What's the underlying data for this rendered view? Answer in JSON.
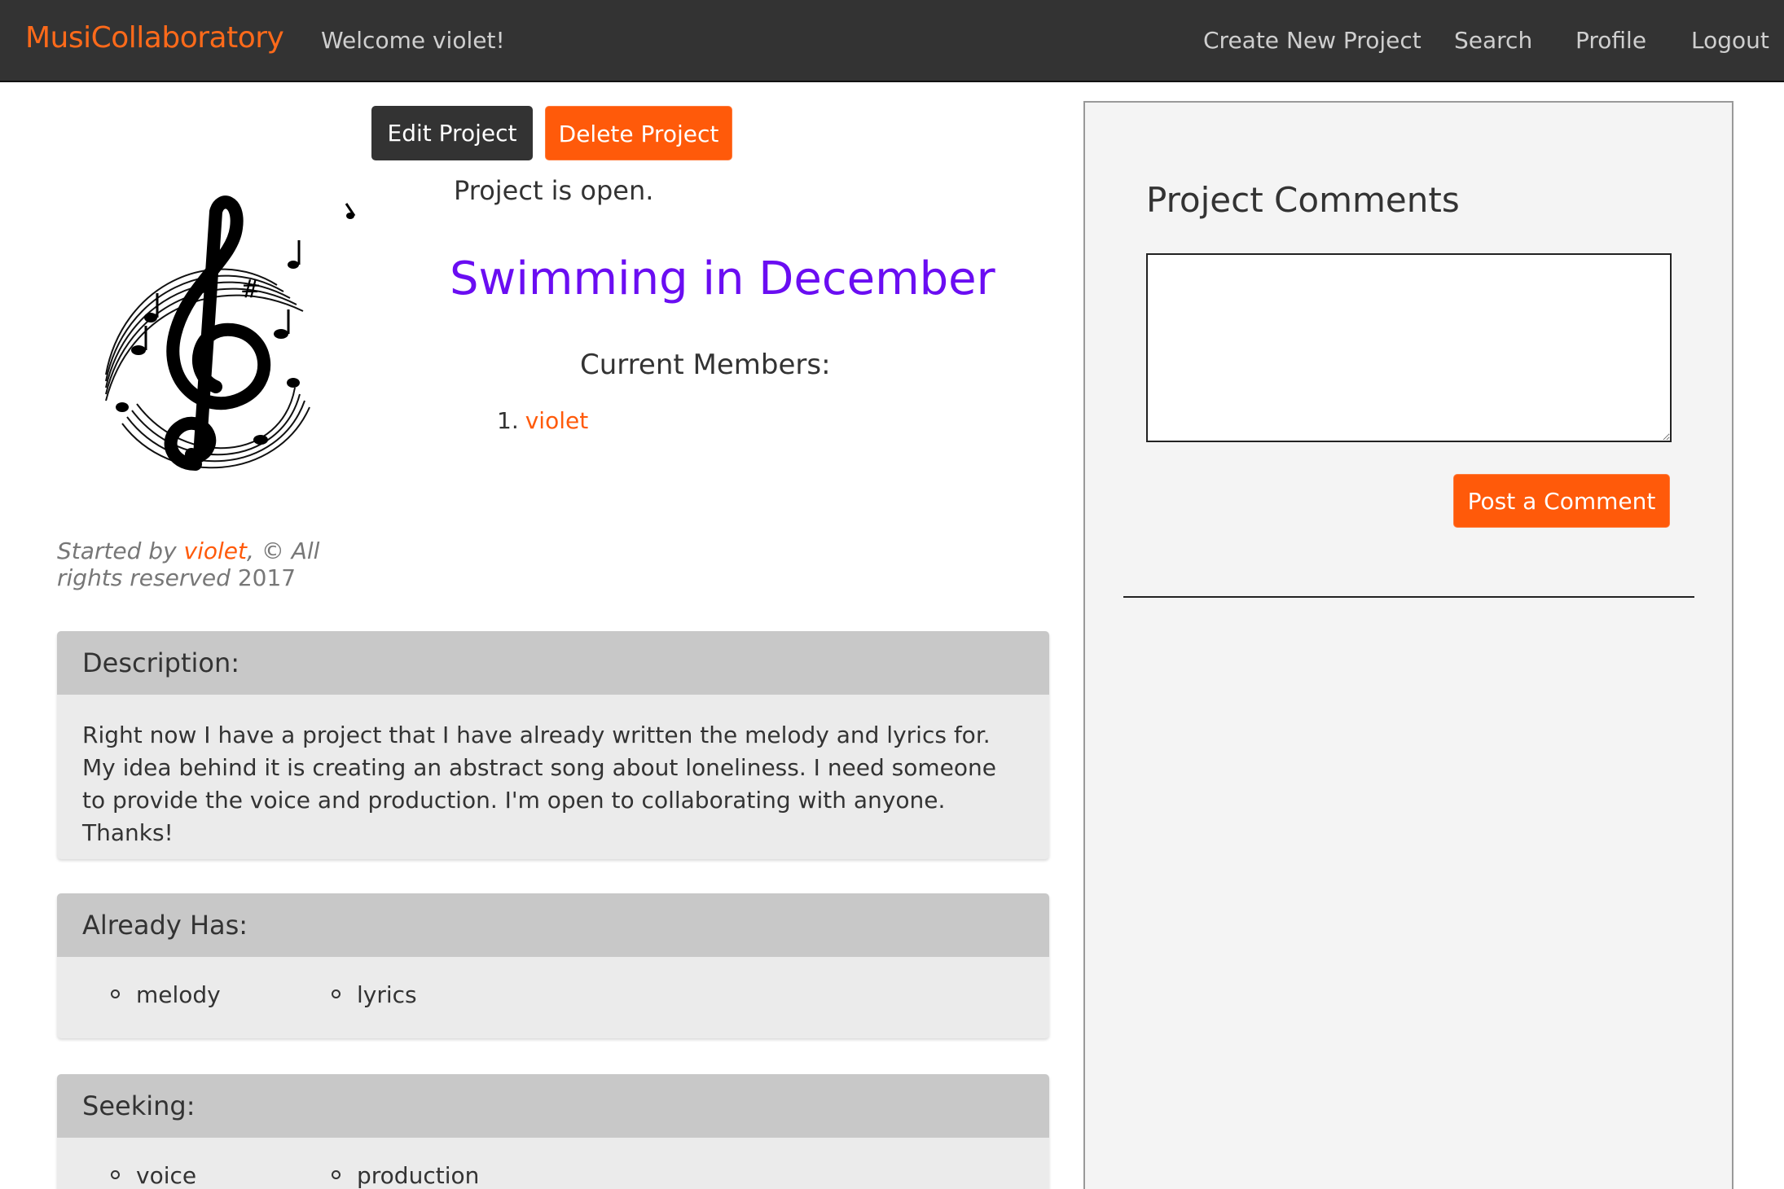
{
  "navbar": {
    "brand": "MusiCollaboratory",
    "welcome": "Welcome violet!",
    "links": [
      "Create New Project",
      "Search",
      "Profile",
      "Logout"
    ]
  },
  "actions": {
    "edit_label": "Edit Project",
    "delete_label": "Delete Project"
  },
  "project": {
    "status": "Project is open.",
    "title": "Swimming in December",
    "members_heading": "Current Members:",
    "members": [
      {
        "number": "1.",
        "name": "violet"
      }
    ],
    "credit": {
      "prefix": "Started by ",
      "author": "violet",
      "suffix": ", © All rights reserved",
      "year": " 2017"
    }
  },
  "description": {
    "heading": "Description:",
    "text": "Right now I have a project that I have already written the melody and lyrics for. My idea behind it is creating an abstract song about loneliness. I need someone to provide the voice and production. I'm open to collaborating with anyone. Thanks!"
  },
  "already_has": {
    "heading": "Already Has:",
    "items": [
      "melody",
      "lyrics"
    ]
  },
  "seeking": {
    "heading": "Seeking:",
    "items": [
      "voice",
      "production"
    ]
  },
  "comments": {
    "title": "Project Comments",
    "input_value": "",
    "post_label": "Post a Comment"
  },
  "colors": {
    "brand_orange": "#ff5a0a",
    "title_purple": "#6a0df2",
    "navbar_bg": "#333333"
  },
  "icons": {
    "project_image": "treble-clef-music-notes-icon"
  }
}
